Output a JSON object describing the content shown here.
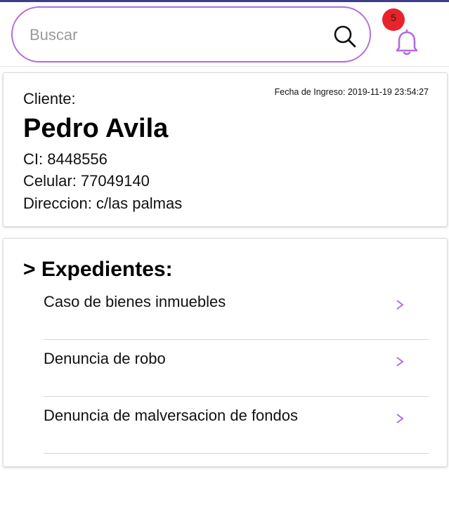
{
  "header": {
    "search": {
      "placeholder": "Buscar",
      "value": ""
    },
    "notifications": {
      "count": "5"
    }
  },
  "client": {
    "label": "Cliente:",
    "fecha": "Fecha de Ingreso: 2019-11-19 23:54:27",
    "name": "Pedro Avila",
    "ci": "CI: 8448556",
    "celular": "Celular: 77049140",
    "direccion": "Direccion: c/las palmas"
  },
  "expedientes": {
    "title": "> Expedientes:",
    "items": [
      {
        "label": "Caso de bienes inmuebles"
      },
      {
        "label": "Denuncia de robo"
      },
      {
        "label": "Denuncia de malversacion de fondos"
      }
    ]
  },
  "colors": {
    "accent": "#b46be0",
    "badge": "#e8232a",
    "topline": "#3f3d8a"
  }
}
